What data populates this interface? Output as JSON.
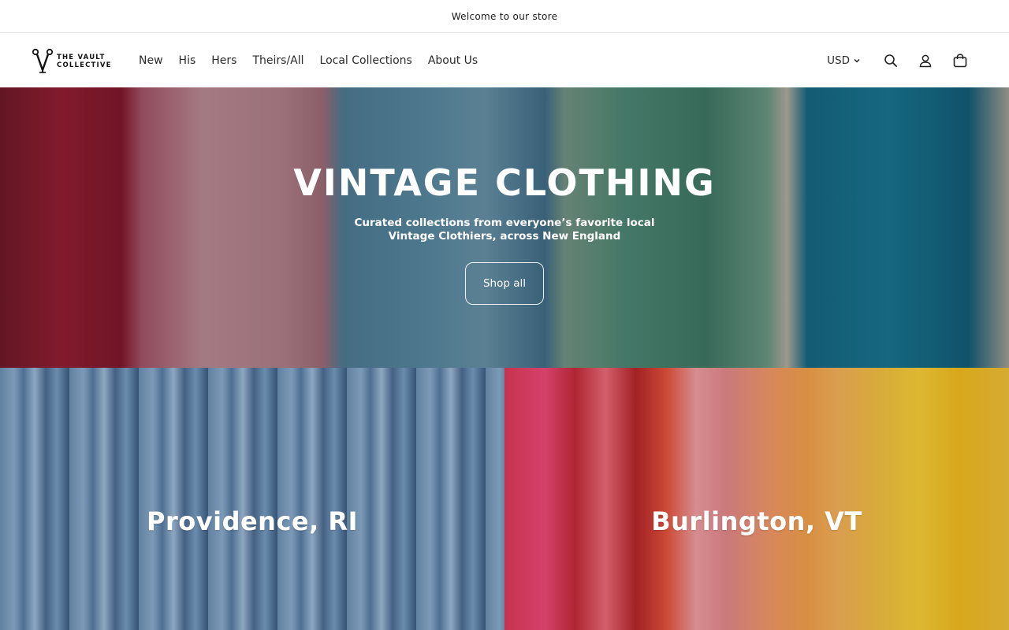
{
  "announcement": {
    "text": "Welcome to our store"
  },
  "header": {
    "logo": {
      "line1": "THE VAULT",
      "line2": "COLLECTIVE"
    },
    "nav": [
      {
        "label": "New"
      },
      {
        "label": "His"
      },
      {
        "label": "Hers"
      },
      {
        "label": "Theirs/All"
      },
      {
        "label": "Local Collections"
      },
      {
        "label": "About Us"
      }
    ],
    "currency": "USD",
    "icons": [
      "search-icon",
      "account-icon",
      "cart-icon"
    ]
  },
  "hero": {
    "title": "VINTAGE CLOTHING",
    "subtitle": "Curated collections from everyone’s favorite local Vintage Clothiers, across New England",
    "button_label": "Shop all"
  },
  "collections": [
    {
      "label": "Providence, RI"
    },
    {
      "label": "Burlington, VT"
    }
  ]
}
